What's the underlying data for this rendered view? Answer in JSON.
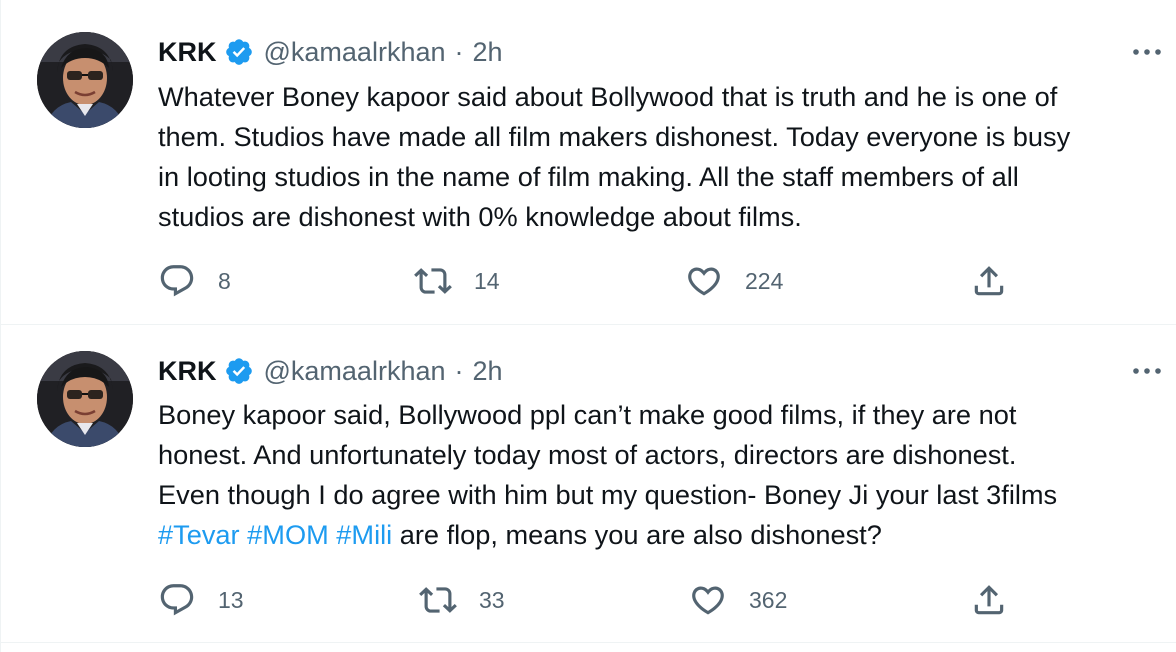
{
  "colors": {
    "accent": "#1d9bf0",
    "text": "#0f1419",
    "secondary": "#536471",
    "divider": "#eff3f4"
  },
  "tweets": [
    {
      "name": "KRK",
      "handle": "@kamaalrkhan",
      "separator": "·",
      "time": "2h",
      "lines": [
        "Whatever Boney kapoor said about Bollywood that is truth and he is one of",
        "them. Studios have made all film makers dishonest. Today everyone is busy",
        "in looting studios in the name of film making. All the staff members of all",
        "studios are dishonest with 0% knowledge about films."
      ],
      "hashtags": [],
      "tail_text": "",
      "replies": "8",
      "retweets": "14",
      "likes": "224",
      "icons": {
        "verified": "verified-badge-icon",
        "more": "more-icon",
        "reply": "reply-icon",
        "retweet": "retweet-icon",
        "like": "like-icon",
        "share": "share-icon"
      }
    },
    {
      "name": "KRK",
      "handle": "@kamaalrkhan",
      "separator": "·",
      "time": "2h",
      "lines": [
        "Boney kapoor said, Bollywood ppl can’t make good films, if they are not",
        "honest. And unfortunately today most of actors, directors are dishonest.",
        "Even though I do agree with him but my question- Boney Ji your last 3films"
      ],
      "hashtags": [
        "#Tevar",
        "#MOM",
        "#Mili"
      ],
      "tail_text": " are flop, means you are also dishonest?",
      "replies": "13",
      "retweets": "33",
      "likes": "362",
      "icons": {
        "verified": "verified-badge-icon",
        "more": "more-icon",
        "reply": "reply-icon",
        "retweet": "retweet-icon",
        "like": "like-icon",
        "share": "share-icon"
      }
    }
  ]
}
